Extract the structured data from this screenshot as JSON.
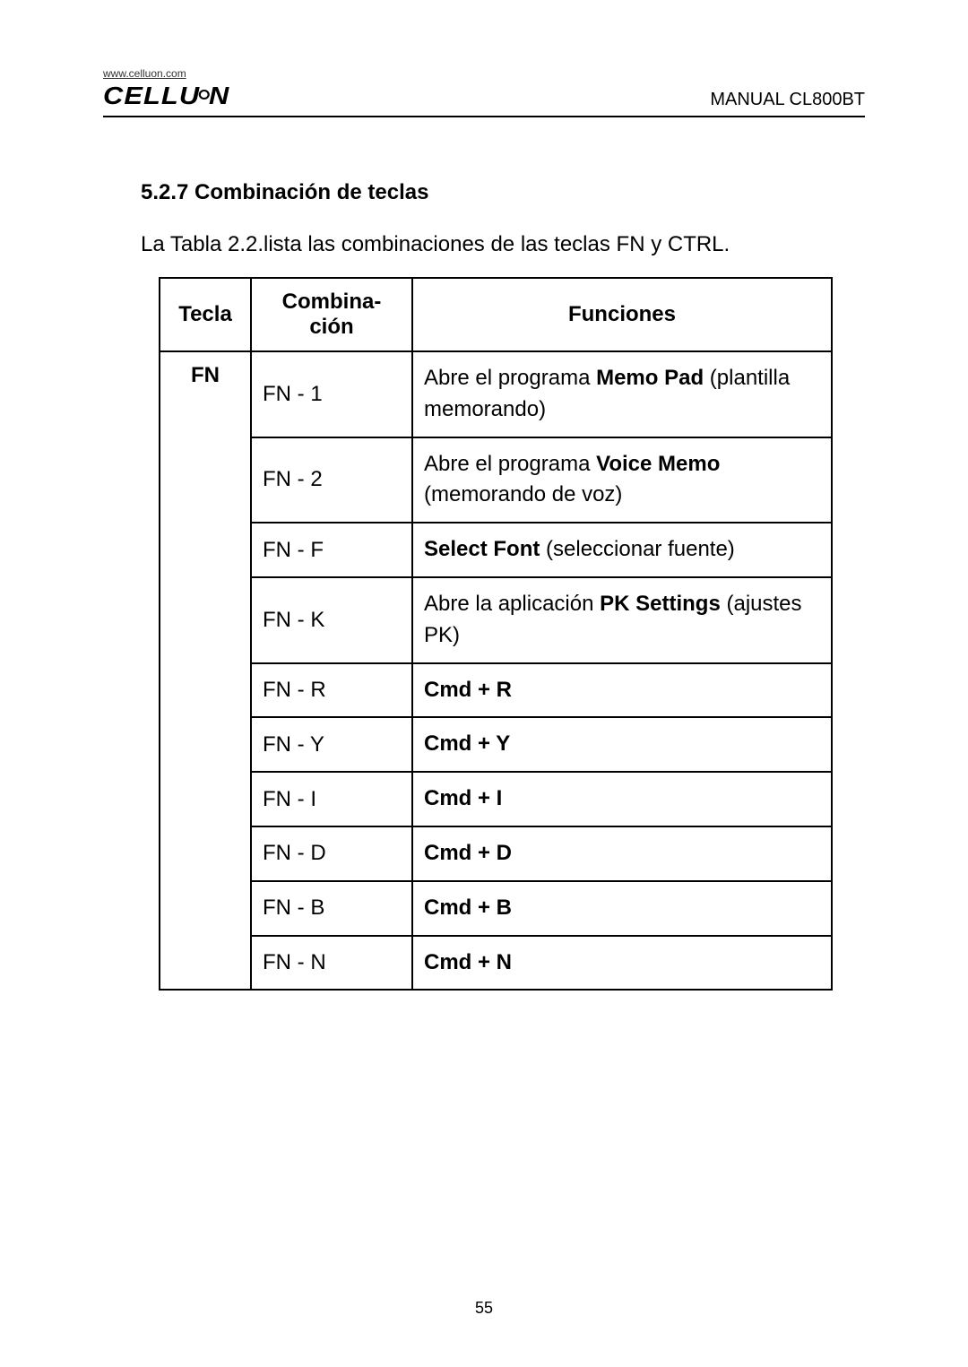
{
  "header": {
    "url": "www.celluon.com",
    "brand_pre": "CELLU",
    "brand_post": "N",
    "manual": "MANUAL CL800BT"
  },
  "section": {
    "title": "5.2.7 Combinación de teclas",
    "intro": "La Tabla 2.2.lista las combinaciones de las teclas FN y CTRL."
  },
  "table": {
    "headers": {
      "tecla": "Tecla",
      "combina": "Combina-",
      "cion": "ción",
      "funciones": "Funciones"
    },
    "key": "FN",
    "rows": [
      {
        "combo": "FN - 1",
        "func_pre": "Abre el programa ",
        "func_b": "Memo Pad",
        "func_post": " (plantilla memorando)"
      },
      {
        "combo": "FN - 2",
        "func_pre": "Abre el programa  ",
        "func_b": "Voice Memo",
        "func_post": " (memorando de voz)"
      },
      {
        "combo": "FN - F",
        "func_pre": "",
        "func_b": "Select Font",
        "func_post": " (seleccionar fuente)"
      },
      {
        "combo": "FN - K",
        "func_pre": "Abre la aplicación ",
        "func_b": "PK Settings",
        "func_post": " (ajustes PK)"
      },
      {
        "combo": "FN - R",
        "func_pre": "",
        "func_b": "Cmd + R",
        "func_post": ""
      },
      {
        "combo": "FN - Y",
        "func_pre": "",
        "func_b": "Cmd + Y",
        "func_post": ""
      },
      {
        "combo": "FN - I",
        "func_pre": "",
        "func_b": "Cmd + I",
        "func_post": ""
      },
      {
        "combo": "FN - D",
        "func_pre": "",
        "func_b": "Cmd + D",
        "func_post": ""
      },
      {
        "combo": "FN - B",
        "func_pre": "",
        "func_b": "Cmd + B",
        "func_post": ""
      },
      {
        "combo": "FN - N",
        "func_pre": "",
        "func_b": "Cmd + N",
        "func_post": ""
      }
    ]
  },
  "page_number": "55"
}
